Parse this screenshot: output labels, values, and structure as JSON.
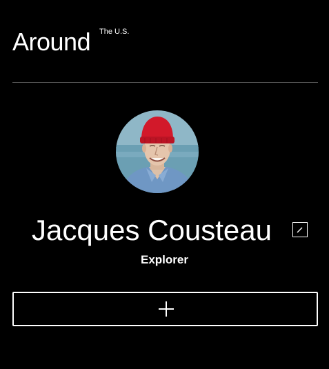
{
  "header": {
    "logo_main": "Around",
    "logo_sup": "The U.S."
  },
  "profile": {
    "name": "Jacques Cousteau",
    "role": "Explorer",
    "avatar_description": "avatar",
    "edit_icon": "pencil-icon"
  },
  "actions": {
    "add_icon": "plus-icon"
  },
  "colors": {
    "background": "#000000",
    "text": "#ffffff",
    "divider": "#595959",
    "hat": "#d2192a",
    "shirt": "#6f97c4",
    "sea": "#7faabb"
  }
}
